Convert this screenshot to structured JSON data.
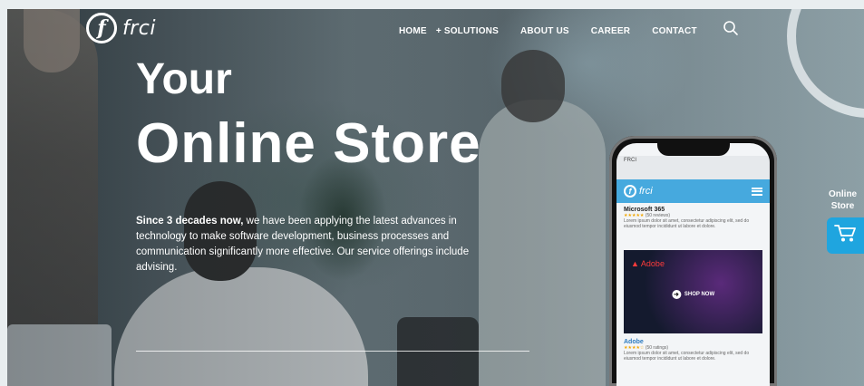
{
  "logo": {
    "mark": "f",
    "text": "frci"
  },
  "nav": {
    "items": [
      {
        "label": "HOME"
      },
      {
        "label": "+ SOLUTIONS"
      },
      {
        "label": "ABOUT US"
      },
      {
        "label": "CAREER"
      },
      {
        "label": "CONTACT"
      }
    ],
    "search_icon": "search-icon"
  },
  "hero": {
    "line1": "Your",
    "line2": "Online Store",
    "desc_bold": "Since 3 decades now,",
    "desc_rest": " we have been applying the latest advances in technology to make software development, business processes and communication significantly more effective. Our service offerings include advising."
  },
  "phone": {
    "browser_title": "FRCI",
    "app_logo": "frci",
    "product1": {
      "title": "Microsoft 365",
      "rating": "★★★★★",
      "reviews": "(50 reviews)",
      "text": "Lorem ipsum dolor sit amet, consectetur adipiscing elit, sed do eiusmod tempor incididunt ut labore et dolore."
    },
    "banner": {
      "brand": "Adobe",
      "cta": "SHOP NOW"
    },
    "product2": {
      "title": "Adobe",
      "rating": "★★★★☆",
      "reviews": "(50 ratings)",
      "text": "Lorem ipsum dolor sit amet, consectetur adipiscing elit, sed do eiusmod tempor incididunt ut labore et dolore."
    }
  },
  "side_widget": {
    "line1": "Online",
    "line2": "Store",
    "icon": "cart-icon"
  },
  "colors": {
    "accent": "#1fa5df",
    "app_bar": "#46a9de"
  }
}
